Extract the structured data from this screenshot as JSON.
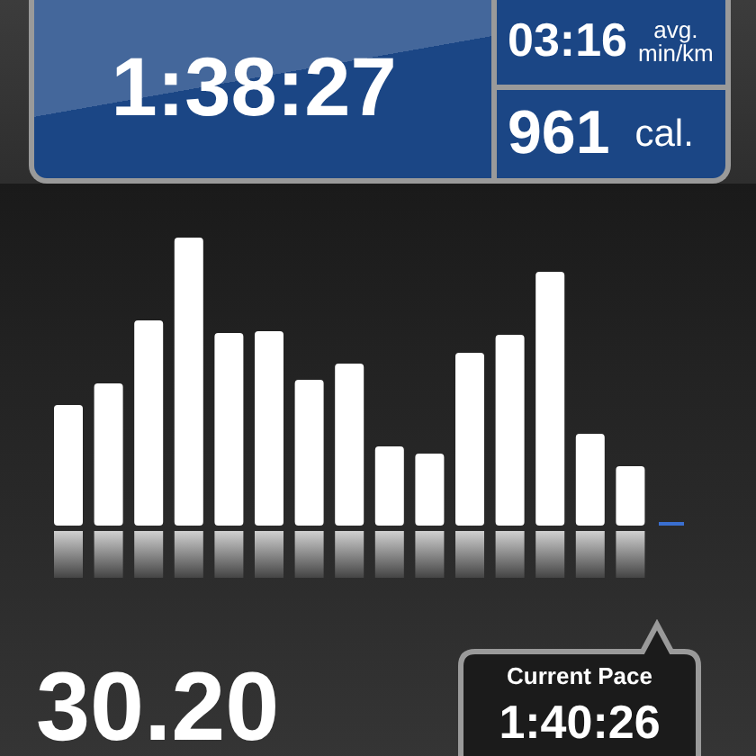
{
  "summary_panel": {
    "duration": "1:38:27",
    "pace": {
      "value": "03:16",
      "label_top": "avg.",
      "unit": "min/km"
    },
    "calories": {
      "value": "961",
      "unit": "cal."
    }
  },
  "distance": "30.20",
  "current_pace": {
    "label": "Current Pace",
    "value": "1:40:26"
  }
}
